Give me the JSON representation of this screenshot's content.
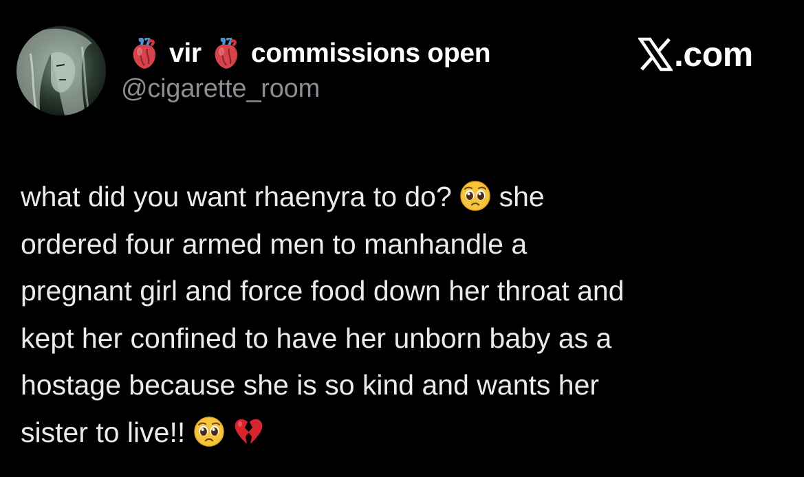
{
  "author": {
    "name_part1": "vir",
    "name_part2": "commissions open",
    "name_emoji": "anatomical-heart-emoji",
    "handle": "@cigarette_room",
    "avatar": "avatar-image"
  },
  "brand": {
    "x_logo": "x-logo-icon",
    "suffix": ".com"
  },
  "tweet": {
    "lines": [
      "what did you want rhaenyra to do?",
      "she",
      "ordered four armed men to manhandle a",
      "pregnant girl and force food down her throat and",
      "kept her confined to have her unborn baby as a",
      "hostage because she is so kind and wants her",
      "sister to live!!"
    ],
    "emojis": [
      "pleading-face-emoji",
      "pleading-face-emoji",
      "broken-heart-emoji"
    ]
  },
  "colors": {
    "background": "#000000",
    "name": "#ffffff",
    "handle": "#8b8f93",
    "body_text": "#ebebeb"
  }
}
